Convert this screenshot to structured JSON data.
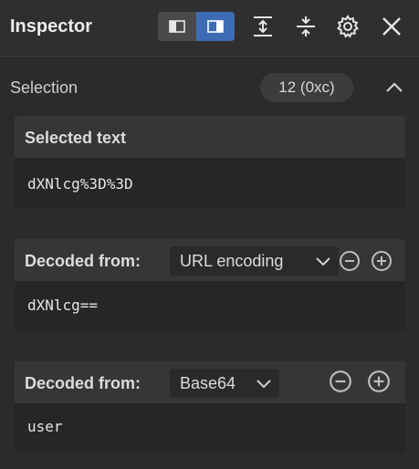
{
  "window": {
    "title": "Inspector",
    "icons": {
      "layout_left": "layout-left-panel-icon",
      "layout_right": "layout-right-panel-icon",
      "expand": "expand-vertical-icon",
      "collapse": "collapse-vertical-icon",
      "settings": "gear-icon",
      "close": "close-icon"
    }
  },
  "selection": {
    "label": "Selection",
    "count": "12 (0xc)",
    "collapse_icon": "chevron-up-icon"
  },
  "selected_text": {
    "title": "Selected text",
    "value": "dXNlcg%3D%3D"
  },
  "decoders": [
    {
      "label": "Decoded from:",
      "encoding": "URL encoding",
      "value": "dXNlcg==",
      "remove_icon": "minus-circle-icon",
      "add_icon": "plus-circle-icon"
    },
    {
      "label": "Decoded from:",
      "encoding": "Base64",
      "value": "user",
      "remove_icon": "minus-circle-icon",
      "add_icon": "plus-circle-icon"
    }
  ],
  "colors": {
    "background": "#2b2b2b",
    "panel": "#363636",
    "body": "#262626",
    "accent": "#3d6cb5"
  }
}
